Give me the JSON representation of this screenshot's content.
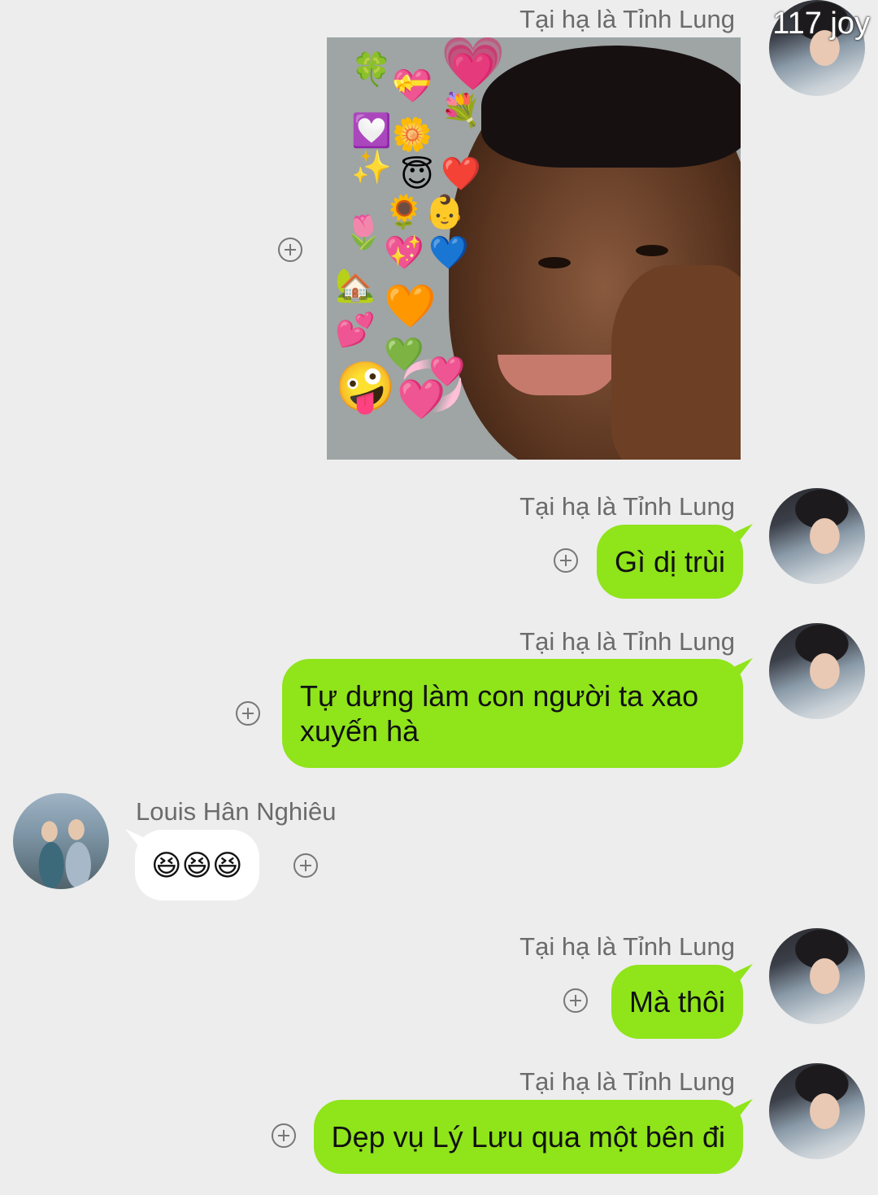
{
  "watermark": "117 joy",
  "messages": [
    {
      "sender": "Tại hạ là Tỉnh Lung",
      "type": "image"
    },
    {
      "sender": "Tại hạ là Tỉnh Lung",
      "text": "Gì dị trùi"
    },
    {
      "sender": "Tại hạ là Tỉnh Lung",
      "text": "Tự dưng làm con người ta xao xuyến hà"
    },
    {
      "sender": "Louis Hân Nghiêu",
      "text": "😆😆😆"
    },
    {
      "sender": "Tại hạ là Tỉnh Lung",
      "text": "Mà thôi"
    },
    {
      "sender": "Tại hạ là Tỉnh Lung",
      "text": "Dẹp vụ Lý Lưu qua một bên đi"
    }
  ],
  "icons": {
    "add": "plus-circle-icon",
    "avatar_self": "avatar",
    "avatar_other": "avatar"
  },
  "colors": {
    "background": "#ededed",
    "self_bubble": "#8fe41a",
    "other_bubble": "#ffffff",
    "sender_name": "#6b6b6b"
  }
}
